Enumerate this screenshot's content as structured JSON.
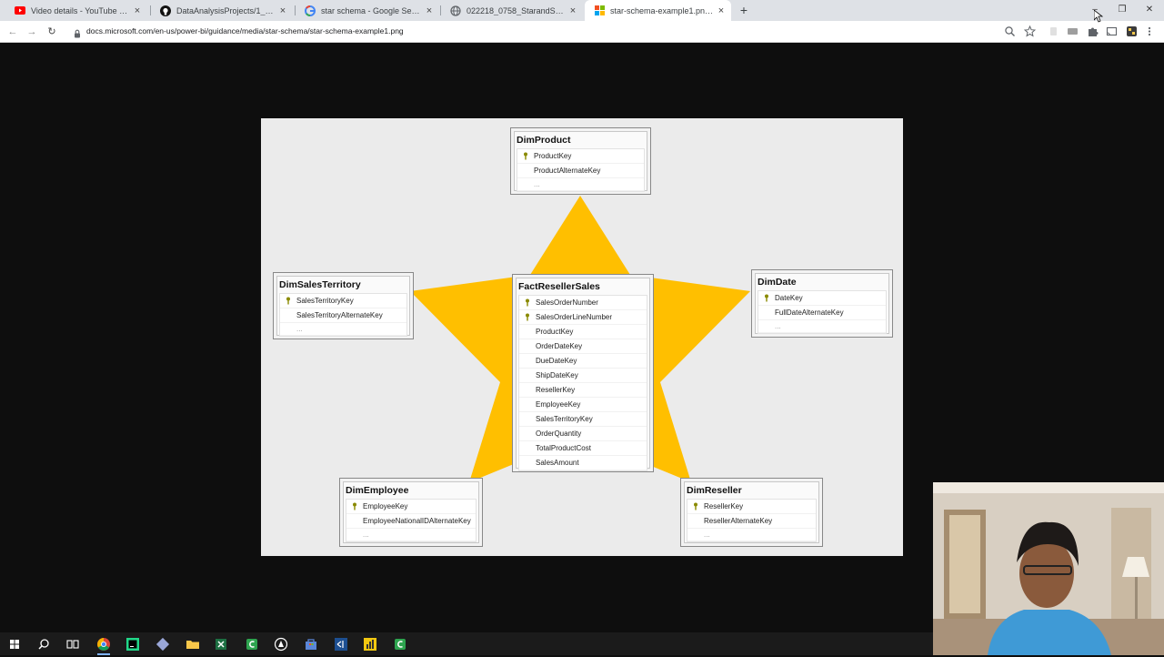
{
  "browser": {
    "tabs": [
      {
        "title": "Video details - YouTube Studio",
        "icon": "youtube-icon",
        "active": false
      },
      {
        "title": "DataAnalysisProjects/1_SalesIns",
        "icon": "github-icon",
        "active": false
      },
      {
        "title": "star schema - Google Search",
        "icon": "google-icon",
        "active": false
      },
      {
        "title": "022218_0758_StarandSnow1.png",
        "icon": "globe-icon",
        "active": false
      },
      {
        "title": "star-schema-example1.png (848",
        "icon": "microsoft-icon",
        "active": true
      }
    ],
    "new_tab": "+",
    "tab_close": "×",
    "url": "docs.microsoft.com/en-us/power-bi/guidance/media/star-schema/star-schema-example1.png",
    "nav": {
      "back": "←",
      "forward": "→",
      "reload": "↻"
    },
    "window": {
      "minimize": "–",
      "restore": "❐",
      "close": "✕"
    }
  },
  "diagram": {
    "colors": {
      "star": "#ffbf00",
      "background": "#ebebeb",
      "key": "#8a8a00"
    },
    "fact": {
      "name": "FactResellerSales",
      "columns": [
        {
          "label": "SalesOrderNumber",
          "key": true
        },
        {
          "label": "SalesOrderLineNumber",
          "key": true
        },
        {
          "label": "ProductKey",
          "key": false
        },
        {
          "label": "OrderDateKey",
          "key": false
        },
        {
          "label": "DueDateKey",
          "key": false
        },
        {
          "label": "ShipDateKey",
          "key": false
        },
        {
          "label": "ResellerKey",
          "key": false
        },
        {
          "label": "EmployeeKey",
          "key": false
        },
        {
          "label": "SalesTerritoryKey",
          "key": false
        },
        {
          "label": "OrderQuantity",
          "key": false
        },
        {
          "label": "TotalProductCost",
          "key": false
        },
        {
          "label": "SalesAmount",
          "key": false
        }
      ]
    },
    "dimensions": {
      "product": {
        "name": "DimProduct",
        "columns": [
          {
            "label": "ProductKey",
            "key": true
          },
          {
            "label": "ProductAlternateKey",
            "key": false
          }
        ],
        "more": "..."
      },
      "sales_territory": {
        "name": "DimSalesTerritory",
        "columns": [
          {
            "label": "SalesTerritoryKey",
            "key": true
          },
          {
            "label": "SalesTerritoryAlternateKey",
            "key": false
          }
        ],
        "more": "..."
      },
      "date": {
        "name": "DimDate",
        "columns": [
          {
            "label": "DateKey",
            "key": true
          },
          {
            "label": "FullDateAlternateKey",
            "key": false
          }
        ],
        "more": "..."
      },
      "employee": {
        "name": "DimEmployee",
        "columns": [
          {
            "label": "EmployeeKey",
            "key": true
          },
          {
            "label": "EmployeeNationalIDAlternateKey",
            "key": false
          }
        ],
        "more": "..."
      },
      "reseller": {
        "name": "DimReseller",
        "columns": [
          {
            "label": "ResellerKey",
            "key": true
          },
          {
            "label": "ResellerAlternateKey",
            "key": false
          }
        ],
        "more": "..."
      }
    }
  },
  "taskbar": {
    "items": [
      {
        "icon": "windows-start-icon",
        "active": false
      },
      {
        "icon": "search-icon",
        "active": false
      },
      {
        "icon": "task-view-icon",
        "active": false
      },
      {
        "icon": "chrome-icon",
        "active": true
      },
      {
        "icon": "pycharm-icon",
        "active": false
      },
      {
        "icon": "git-icon",
        "active": false
      },
      {
        "icon": "file-explorer-icon",
        "active": false
      },
      {
        "icon": "excel-icon",
        "active": false
      },
      {
        "icon": "camtasia-icon",
        "active": false
      },
      {
        "icon": "app-icon",
        "active": false
      },
      {
        "icon": "store-icon",
        "active": false
      },
      {
        "icon": "vscode-icon",
        "active": false
      },
      {
        "icon": "powerbi-icon",
        "active": false
      },
      {
        "icon": "camtasia-recorder-icon",
        "active": false
      }
    ]
  },
  "webcam": {
    "icon": "webcam-presenter"
  }
}
